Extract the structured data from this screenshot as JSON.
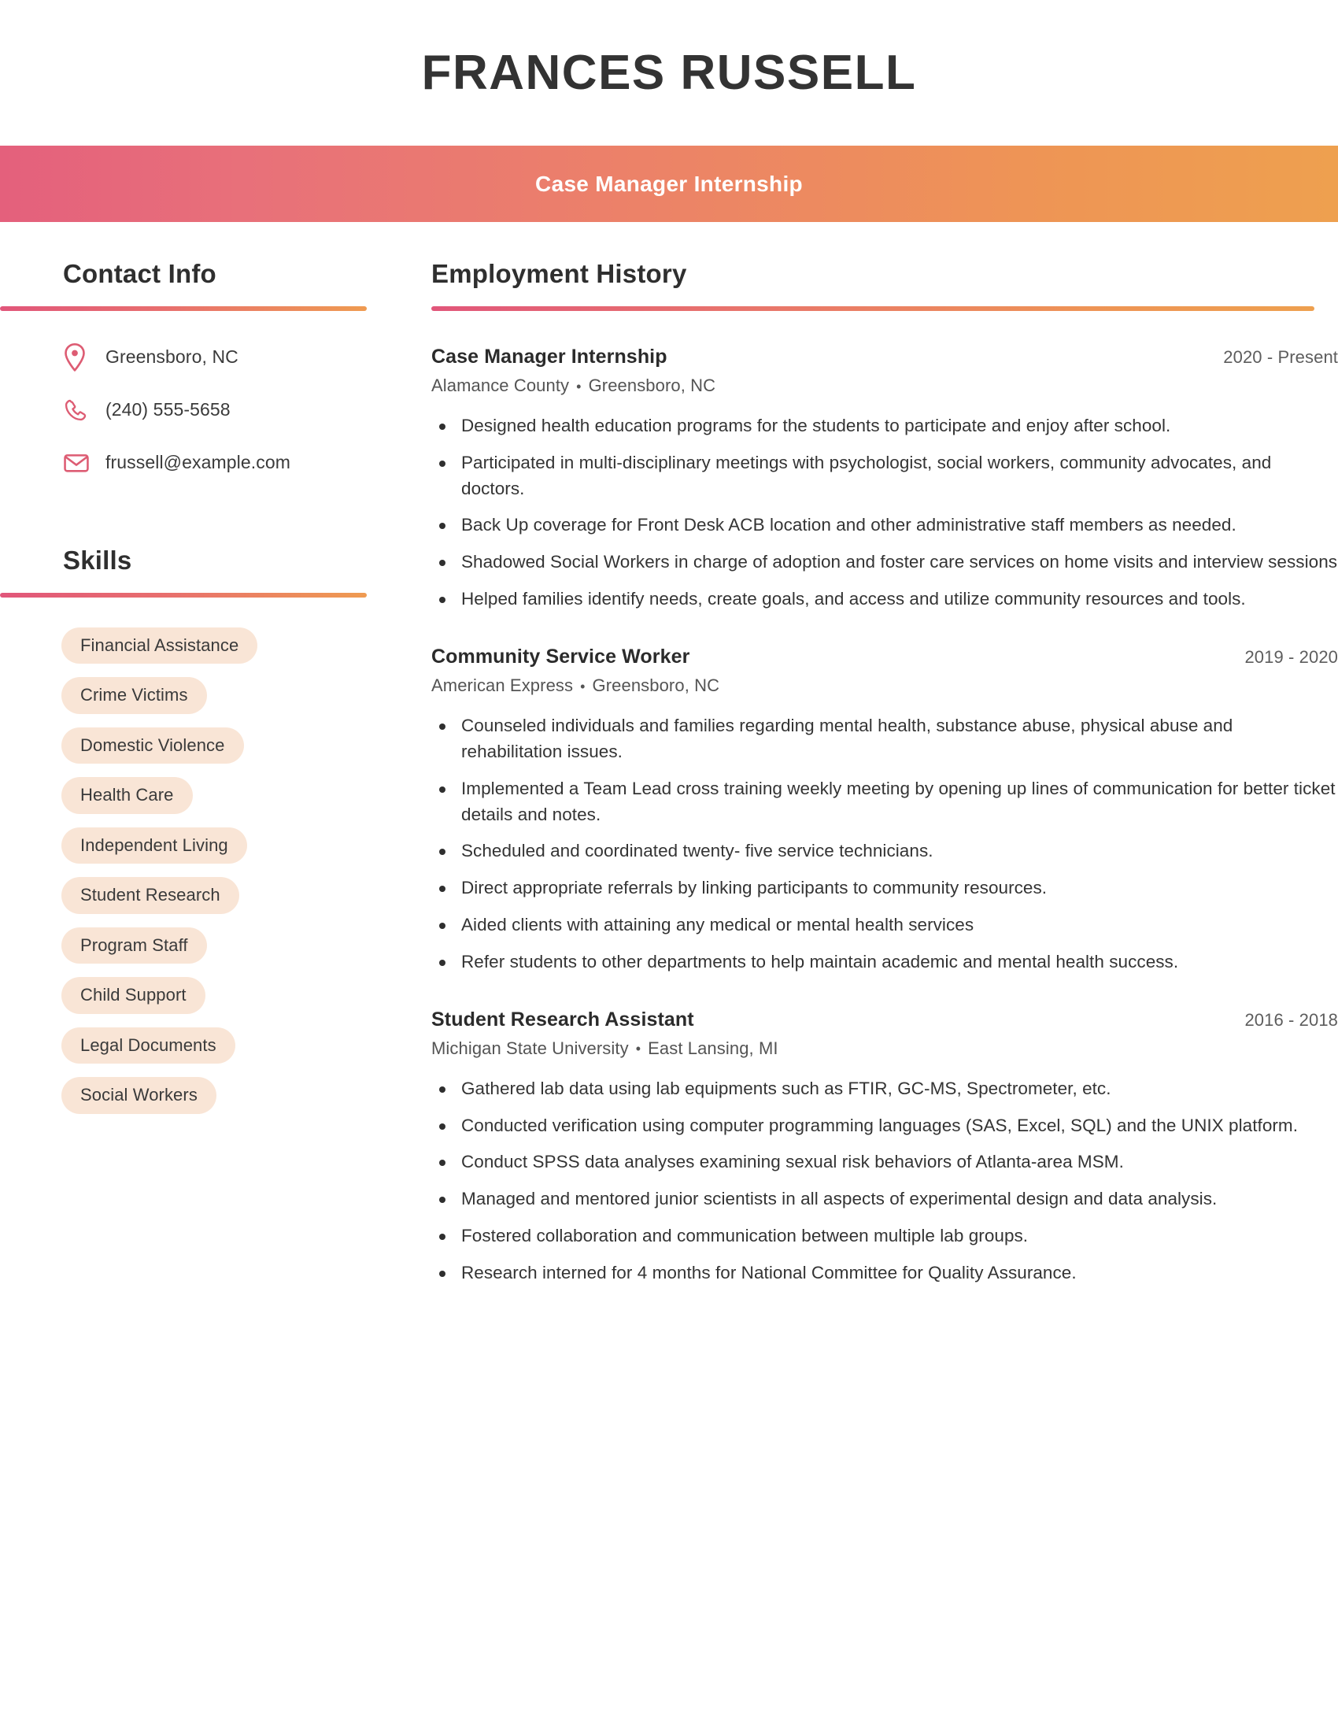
{
  "header": {
    "full_name": "FRANCES RUSSELL",
    "job_title": "Case Manager Internship",
    "gradient_start_color": "#e4607c",
    "gradient_end_color": "#eea04f"
  },
  "sidebar": {
    "contact": {
      "heading": "Contact Info",
      "items": [
        {
          "icon": "location-pin-icon",
          "value": "Greensboro, NC"
        },
        {
          "icon": "phone-icon",
          "value": "(240) 555-5658"
        },
        {
          "icon": "envelope-icon",
          "value": "frussell@example.com"
        }
      ]
    },
    "skills": {
      "heading": "Skills",
      "pill_background_color": "#f9e5d6",
      "items": [
        "Financial Assistance",
        "Crime Victims",
        "Domestic Violence",
        "Health Care",
        "Independent Living",
        "Student Research",
        "Program Staff",
        "Child Support",
        "Legal Documents",
        "Social Workers"
      ]
    }
  },
  "main": {
    "employment": {
      "heading": "Employment History",
      "jobs": [
        {
          "position": "Case Manager Internship",
          "dates": "2020 - Present",
          "company": "Alamance County",
          "location": "Greensboro, NC",
          "bullets": [
            "Designed health education programs for the students to participate and enjoy after school.",
            "Participated in multi-disciplinary meetings with psychologist, social workers, community advocates, and doctors.",
            "Back Up coverage for Front Desk ACB location and other administrative staff members as needed.",
            "Shadowed Social Workers in charge of adoption and foster care services on home visits and interview sessions",
            "Helped families identify needs, create goals, and access and utilize community resources and tools."
          ]
        },
        {
          "position": "Community Service Worker",
          "dates": "2019 - 2020",
          "company": "American Express",
          "location": "Greensboro, NC",
          "bullets": [
            "Counseled individuals and families regarding mental health, substance abuse, physical abuse and rehabilitation issues.",
            "Implemented a Team Lead cross training weekly meeting by opening up lines of communication for better ticket details and notes.",
            "Scheduled and coordinated twenty- five service technicians.",
            "Direct appropriate referrals by linking participants to community resources.",
            "Aided clients with attaining any medical or mental health services",
            "Refer students to other departments to help maintain academic and mental health success."
          ]
        },
        {
          "position": "Student Research Assistant",
          "dates": "2016 - 2018",
          "company": "Michigan State University",
          "location": "East Lansing, MI",
          "bullets": [
            "Gathered lab data using lab equipments such as FTIR, GC-MS, Spectrometer, etc.",
            "Conducted verification using computer programming languages (SAS, Excel, SQL) and the UNIX platform.",
            "Conduct SPSS data analyses examining sexual risk behaviors of Atlanta-area MSM.",
            "Managed and mentored junior scientists in all aspects of experimental design and data analysis.",
            "Fostered collaboration and communication between multiple lab groups.",
            "Research interned for 4 months for National Committee for Quality Assurance."
          ]
        }
      ]
    }
  },
  "meta": {
    "separator_bullet": "•",
    "icon_color": "#dd5c73",
    "heading_color": "#2f2f2f"
  }
}
